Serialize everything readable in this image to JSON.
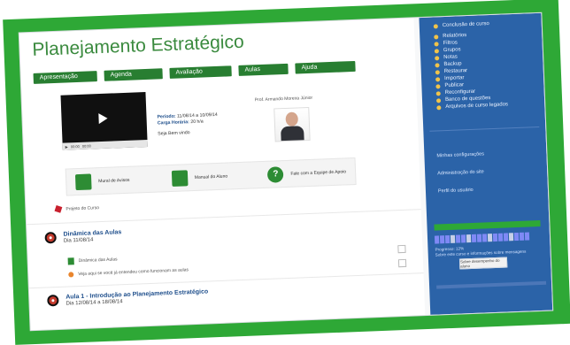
{
  "course": {
    "title": "Planejamento Estratégico",
    "nav": [
      "Apresentação",
      "Agenda",
      "Avaliação",
      "Aulas",
      "Ajuda"
    ],
    "professor": "Prof. Armando Moreira Júnior",
    "periodo_label": "Período:",
    "periodo": "11/08/14 a 10/09/14",
    "carga_label": "Carga Horária:",
    "carga": "20 h/a",
    "welcome": "Seja Bem vindo",
    "actions": [
      "Mural de Avisos",
      "Manual do Aluno",
      "Fale com a Equipe de Apoio"
    ],
    "project_link": "Projeto do Curso",
    "section1": {
      "title": "Dinâmica das Aulas",
      "date": "Dia 11/08/14",
      "items": [
        "Dinâmica das Aulas",
        "Veja aqui se você já entendeu como funcionam as aulas"
      ]
    },
    "section2": {
      "title": "Aula 1 - Introdução ao Planejamento Estratégico",
      "date": "Dia 12/08/14 a 18/08/14"
    },
    "video": {
      "time_left": "00:00",
      "time_right": "00:00"
    }
  },
  "sidebar": {
    "top_link": "Conclusão de curso",
    "menu": [
      "Relatórios",
      "Filtros",
      "Grupos",
      "Notas",
      "Backup",
      "Restaurar",
      "Importar",
      "Publicar",
      "Reconfigurar",
      "Banco de questões",
      "Arquivos de curso legados"
    ],
    "nav_links": [
      "Minhas configurações",
      "Administração do site",
      "Perfil do usuário"
    ],
    "progress": {
      "label": "Progresso: 12%",
      "note": "Sobre este curso e informações sobre mensagens",
      "button": "Sobre desempenho do aluno"
    }
  },
  "colors": {
    "accent": "#2ea836",
    "sidebar": "#2b63a8",
    "nav": "#287e31"
  }
}
